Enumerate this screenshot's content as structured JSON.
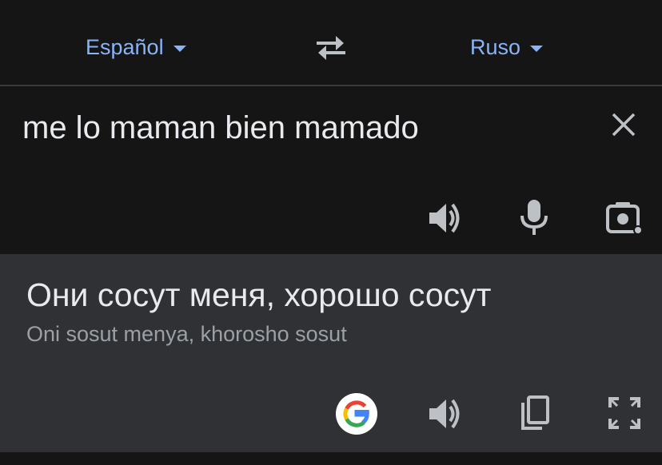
{
  "languages": {
    "source_label": "Español",
    "target_label": "Ruso"
  },
  "source": {
    "text": "me lo maman bien mamado"
  },
  "result": {
    "translation": "Они сосут меня, хорошо сосут",
    "transliteration": "Oni sosut menya, khorosho sosut"
  },
  "icons": {
    "swap": "swap-arrows-icon",
    "clear": "close-icon",
    "speak": "speaker-icon",
    "mic": "microphone-icon",
    "camera": "camera-lens-icon",
    "google": "google-logo-icon",
    "copy": "copy-icon",
    "fullscreen": "fullscreen-icon"
  },
  "colors": {
    "accent": "#8ab4f8",
    "background": "#151515",
    "result_background": "#303134",
    "text_primary": "#e8eaed",
    "text_secondary": "#9aa0a6",
    "icon": "#bdc1c6"
  }
}
